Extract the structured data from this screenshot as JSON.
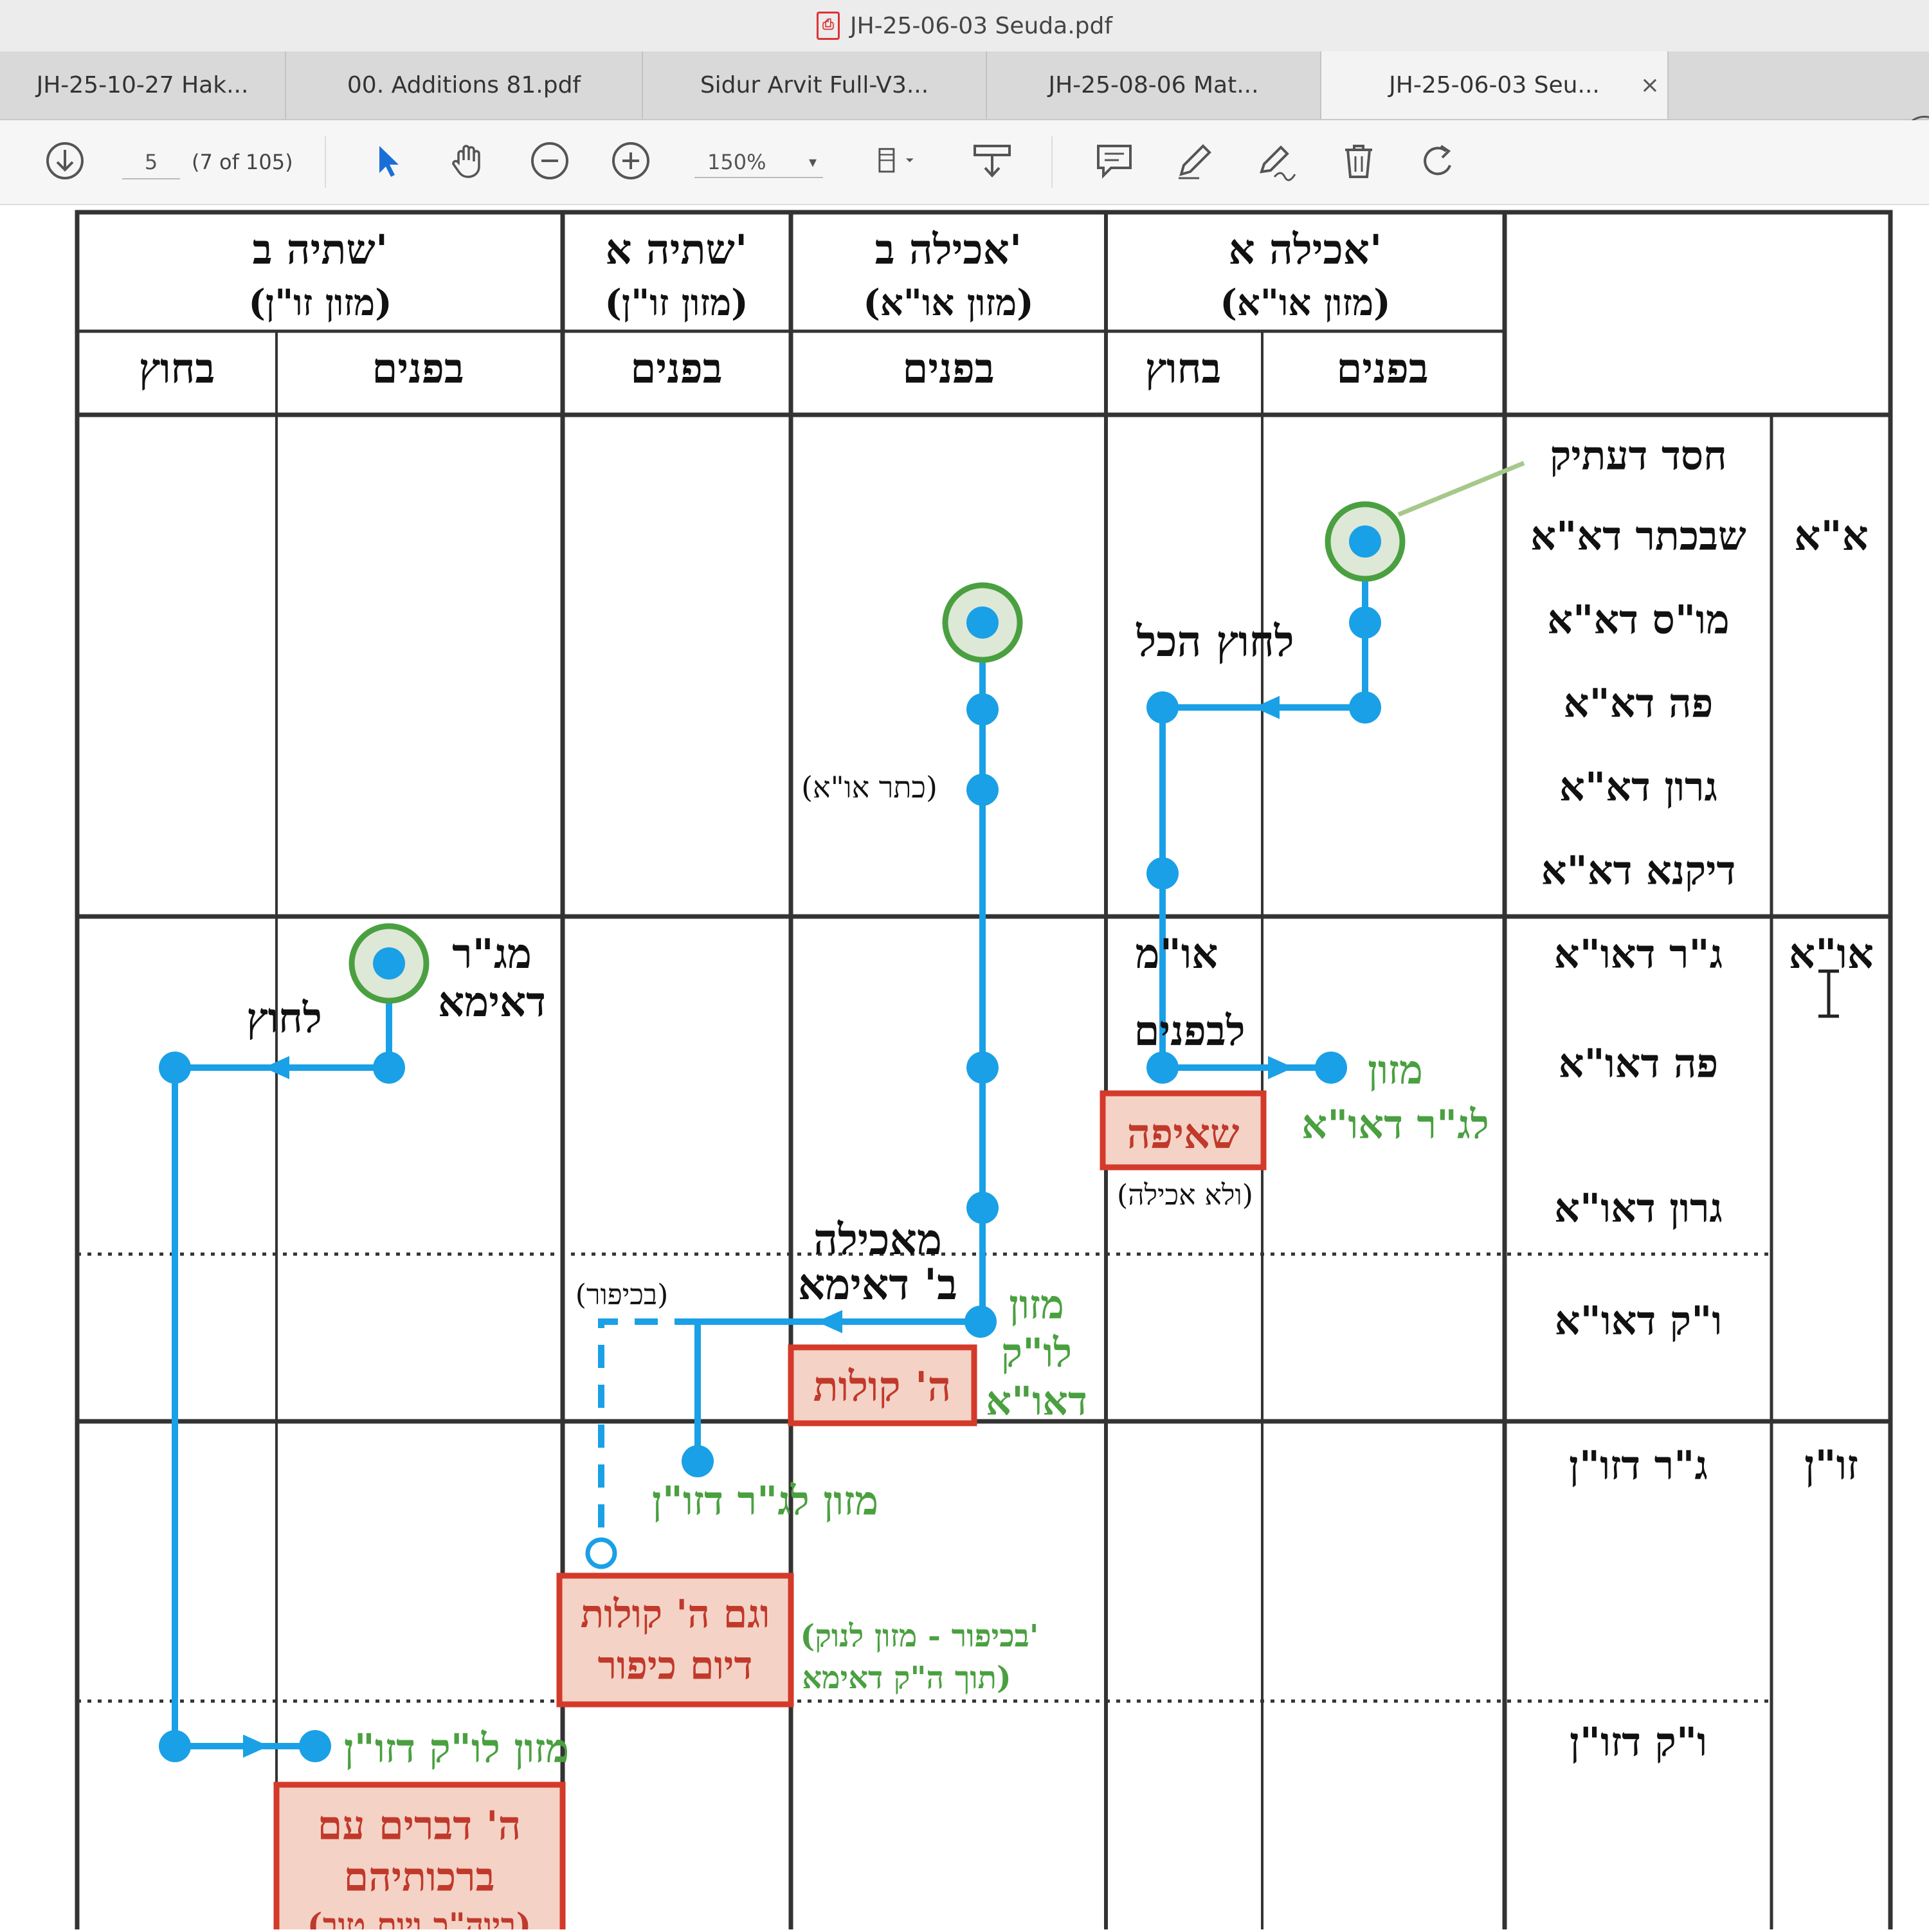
{
  "window": {
    "title": "JH-25-06-03 Seuda.pdf"
  },
  "tabs": [
    {
      "label": "JH-25-10-27 Hak..."
    },
    {
      "label": "00. Additions 81.pdf"
    },
    {
      "label": "Sidur Arvit Full-V3..."
    },
    {
      "label": "JH-25-08-06 Mat..."
    },
    {
      "label": "JH-25-06-03 Seu...",
      "close": "×"
    }
  ],
  "help_label": "?",
  "toolbar": {
    "page_value": "5",
    "page_count": "(7 of 105)",
    "zoom": "150%"
  },
  "icons": [
    "download-icon",
    "select-arrow-icon",
    "hand-icon",
    "zoom-out-icon",
    "zoom-in-icon",
    "fit-page-icon",
    "scroll-icon",
    "comment-icon",
    "pen-icon",
    "sign-icon",
    "trash-icon",
    "rotate-icon"
  ],
  "colors": {
    "blue": "#1aa0e6",
    "green": "#4aa040",
    "red": "#d43a2a",
    "redfill": "#f4d3c6",
    "text": "#111"
  },
  "table": {
    "headers": {
      "h1": {
        "title": "אכילה א'",
        "sub": "(מזון או\"א)"
      },
      "h2": {
        "title": "אכילה ב'",
        "sub": "(מזון או\"א)"
      },
      "h3": {
        "title": "שתיה א'",
        "sub": "(מזון זו\"ן)"
      },
      "h4": {
        "title": "שתיה ב'",
        "sub": "(מזון זו\"ן)"
      }
    },
    "subheaders": {
      "inside": "בפנים",
      "outside": "בחוץ"
    },
    "groups": {
      "aa": "א\"א",
      "ao": "או\"א",
      "zon": "זו\"ן"
    },
    "rows": [
      "חסד דעתיק",
      "שבכתר דא\"א",
      "מו\"ס דא\"א",
      "פה דא\"א",
      "גרון דא\"א",
      "דיקנא דא\"א",
      "ג\"ר דאו\"א",
      "פה דאו\"א",
      "גרון דאו\"א",
      "ו\"ק דאו\"א",
      "ג\"ר דזו\"ן",
      "ו\"ק דזו\"ן"
    ]
  },
  "annotations": {
    "lachutz_hakol": "לחוץ הכל",
    "keter": "(כתר או\"א)",
    "aom": "או\"מ",
    "lifnim": "לבפנים",
    "mazon_ao_1": "מזון",
    "mazon_ao_2": "לג\"ר דאו\"א",
    "sheifa": "שאיפה",
    "velo": "(ולא אכילה)",
    "meachila_1": "מאכילה",
    "meachila_2": "ב' דאימא",
    "mazon_vk_1": "מזון",
    "mazon_vk_2": "לו\"ק",
    "mazon_vk_3": "דאו\"א",
    "hey_kolot": "ה' קולות",
    "bekipur": "(בכיפור)",
    "mazon_gr_zon": "מזון לג\"ר דזו\"ן",
    "vegam_1": "וגם ה' קולות",
    "vegam_2": "דיום כיפור",
    "kipur_note_1": "(בכיפור - מזון לנוק'",
    "kipur_note_2": "תוך ה\"ק דאימא)",
    "magar_1": "מג\"ר",
    "magar_2": "דאימא",
    "lachutz": "לחוץ",
    "mazon_vk_zon": "מזון לו\"ק דזו\"ן",
    "hey_devarim_1": "ה' דברים עם",
    "hey_devarim_2": "ברכותיהם",
    "hey_devarim_3": "(ביוה\"כ ויום טוב)"
  }
}
